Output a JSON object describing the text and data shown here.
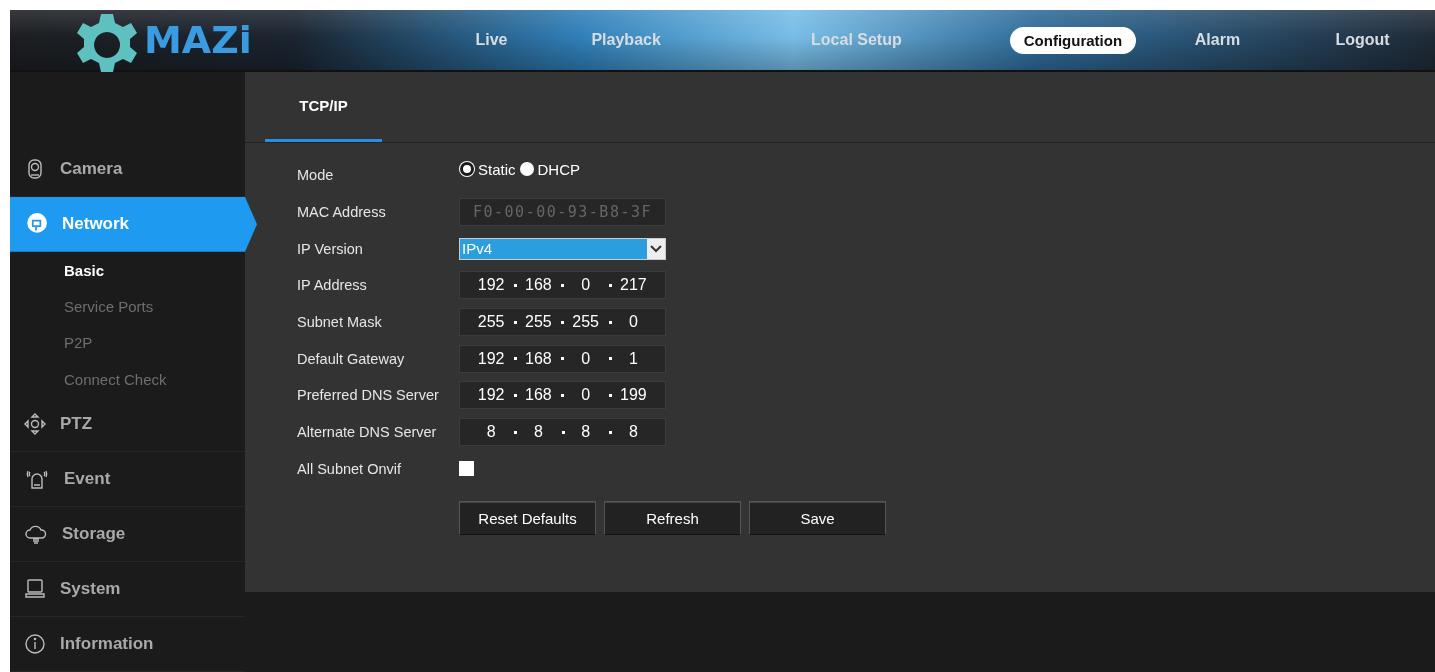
{
  "logo": {
    "text": "MAZi"
  },
  "nav": [
    {
      "label": "Live",
      "selected": false
    },
    {
      "label": "Playback",
      "selected": false
    },
    {
      "label": "Local Setup",
      "selected": false
    },
    {
      "label": "Configuration",
      "selected": true
    },
    {
      "label": "Alarm",
      "selected": false
    },
    {
      "label": "Logout",
      "selected": false
    }
  ],
  "sidebar": {
    "items": [
      {
        "kind": "camera",
        "label": "Camera",
        "selected": false
      },
      {
        "kind": "network",
        "label": "Network",
        "selected": true,
        "children": [
          {
            "label": "Basic",
            "selected": true
          },
          {
            "label": "Service Ports",
            "selected": false
          },
          {
            "label": "P2P",
            "selected": false
          },
          {
            "label": "Connect Check",
            "selected": false
          }
        ]
      },
      {
        "kind": "ptz",
        "label": "PTZ",
        "selected": false
      },
      {
        "kind": "event",
        "label": "Event",
        "selected": false
      },
      {
        "kind": "storage",
        "label": "Storage",
        "selected": false
      },
      {
        "kind": "system",
        "label": "System",
        "selected": false
      },
      {
        "kind": "information",
        "label": "Information",
        "selected": false
      }
    ]
  },
  "tabs": [
    {
      "label": "TCP/IP",
      "selected": true
    }
  ],
  "form": {
    "rows": [
      {
        "kind": "radio",
        "label": "Mode",
        "options": [
          {
            "label": "Static",
            "selected": true
          },
          {
            "label": "DHCP",
            "selected": false
          }
        ]
      },
      {
        "kind": "text",
        "label": "MAC Address",
        "value": "F0-00-00-93-B8-3F",
        "disabled": true
      },
      {
        "kind": "select",
        "label": "IP Version",
        "value": "IPv4"
      },
      {
        "kind": "ip",
        "label": "IP Address",
        "octets": [
          "192",
          "168",
          "0",
          "217"
        ]
      },
      {
        "kind": "ip",
        "label": "Subnet Mask",
        "octets": [
          "255",
          "255",
          "255",
          "0"
        ]
      },
      {
        "kind": "ip",
        "label": "Default Gateway",
        "octets": [
          "192",
          "168",
          "0",
          "1"
        ]
      },
      {
        "kind": "ip",
        "label": "Preferred DNS Server",
        "octets": [
          "192",
          "168",
          "0",
          "199"
        ]
      },
      {
        "kind": "ip",
        "label": "Alternate DNS Server",
        "octets": [
          "8",
          "8",
          "8",
          "8"
        ]
      },
      {
        "kind": "checkbox",
        "label": "All Subnet Onvif",
        "checked": false
      }
    ]
  },
  "buttons": [
    "Reset Defaults",
    "Refresh",
    "Save"
  ]
}
